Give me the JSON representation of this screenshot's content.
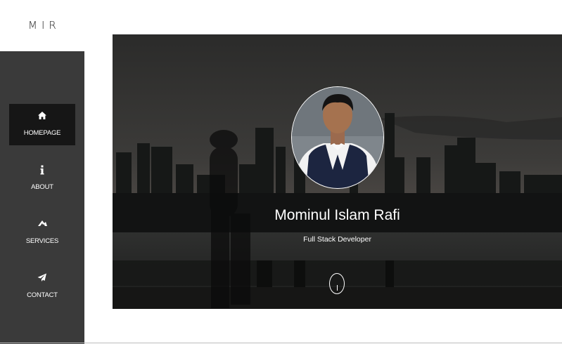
{
  "brand": {
    "logo_text": "MIR"
  },
  "nav": {
    "items": [
      {
        "label": "HOMEPAGE",
        "icon": "home-icon",
        "active": true
      },
      {
        "label": "ABOUT",
        "icon": "info-icon",
        "active": false
      },
      {
        "label": "SERVICES",
        "icon": "services-icon",
        "active": false
      },
      {
        "label": "CONTACT",
        "icon": "paper-plane-icon",
        "active": false
      }
    ]
  },
  "hero": {
    "name": "Mominul Islam Rafi",
    "role": "Full Stack Developer",
    "scroll_icon": "mouse-scroll-icon"
  },
  "colors": {
    "sidebar_bg": "#3a3a3a",
    "active_bg": "#161616",
    "text_light": "#ffffff"
  }
}
